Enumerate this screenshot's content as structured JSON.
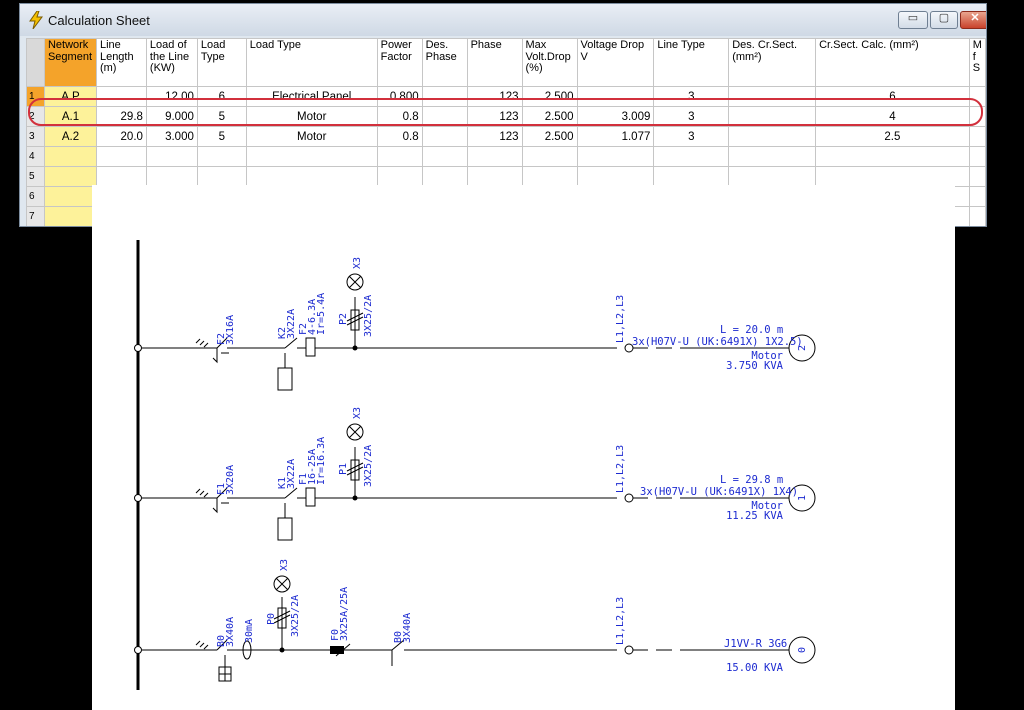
{
  "window": {
    "title": "Calculation Sheet",
    "buttons": {
      "minimize": "▭",
      "maximize": "▢",
      "close": "✕"
    }
  },
  "table": {
    "headers": [
      "Network Segment",
      "Line Length (m)",
      "Load of the Line (KW)",
      "Load Type",
      "Load Type",
      "Power Factor",
      "Des. Phase",
      "Phase",
      "Max Volt.Drop (%)",
      "Voltage Drop V",
      "Line Type",
      "Des. Cr.Sect. (mm²)",
      "Cr.Sect. Calc. (mm²)",
      "M f S"
    ],
    "rows": [
      {
        "num": "1",
        "cells": [
          "A.P",
          "",
          "12.00",
          "6",
          "Electrical Panel",
          "0.800",
          "",
          "123",
          "2.500",
          "",
          "3",
          "",
          "6",
          ""
        ]
      },
      {
        "num": "2",
        "cells": [
          "A.1",
          "29.8",
          "9.000",
          "5",
          "Motor",
          "0.8",
          "",
          "123",
          "2.500",
          "3.009",
          "3",
          "",
          "4",
          ""
        ]
      },
      {
        "num": "3",
        "cells": [
          "A.2",
          "20.0",
          "3.000",
          "5",
          "Motor",
          "0.8",
          "",
          "123",
          "2.500",
          "1.077",
          "3",
          "",
          "2.5",
          ""
        ]
      },
      {
        "num": "4",
        "cells": [
          "",
          "",
          "",
          "",
          "",
          "",
          "",
          "",
          "",
          "",
          "",
          "",
          "",
          ""
        ]
      },
      {
        "num": "5",
        "cells": [
          "",
          "",
          "",
          "",
          "",
          "",
          "",
          "",
          "",
          "",
          "",
          "",
          "",
          ""
        ]
      },
      {
        "num": "6",
        "cells": [
          "",
          "",
          "",
          "",
          "",
          "",
          "",
          "",
          "",
          "",
          "",
          "",
          "",
          ""
        ]
      },
      {
        "num": "7",
        "cells": [
          "",
          "",
          "",
          "",
          "",
          "",
          "",
          "",
          "",
          "",
          "",
          "",
          "",
          ""
        ]
      }
    ]
  },
  "diagram": {
    "circuit2": {
      "breaker": [
        "F2",
        "3X16A"
      ],
      "contactor": [
        "K2",
        "3X22A"
      ],
      "relay": [
        "F2",
        "4-6.3A",
        "Ir=5.4A"
      ],
      "fuse": [
        "P2",
        "3X25/2A"
      ],
      "lamp": "X3",
      "phases": "L1,L2,L3",
      "cable": "3x(H07V-U (UK:6491X) 1X2.5)",
      "length": "L = 20.0 m",
      "load_name": "Motor",
      "power": "3.750 KVA",
      "motor": "2"
    },
    "circuit1": {
      "breaker": [
        "F1",
        "3X20A"
      ],
      "contactor": [
        "K1",
        "3X22A"
      ],
      "relay": [
        "F1",
        "16-25A",
        "Ir=16.3A"
      ],
      "fuse": [
        "P1",
        "3X25/2A"
      ],
      "lamp": "X3",
      "phases": "L1,L2,L3",
      "cable": "3x(H07V-U (UK:6491X) 1X4)",
      "length": "L = 29.8 m",
      "load_name": "Motor",
      "power": "11.25 KVA",
      "motor": "1"
    },
    "circuit0": {
      "breaker": [
        "B0",
        "3X40A"
      ],
      "rcd": "30mA",
      "fuse": [
        "P0",
        "3X25/2A"
      ],
      "lamp": "X3",
      "fuse2": [
        "F0",
        "3X25A/25A"
      ],
      "switch": [
        "B0",
        "3X40A"
      ],
      "phases": "L1,L2,L3",
      "cable": "J1VV-R 3G6",
      "power": "15.00 KVA",
      "motor": "0"
    }
  }
}
